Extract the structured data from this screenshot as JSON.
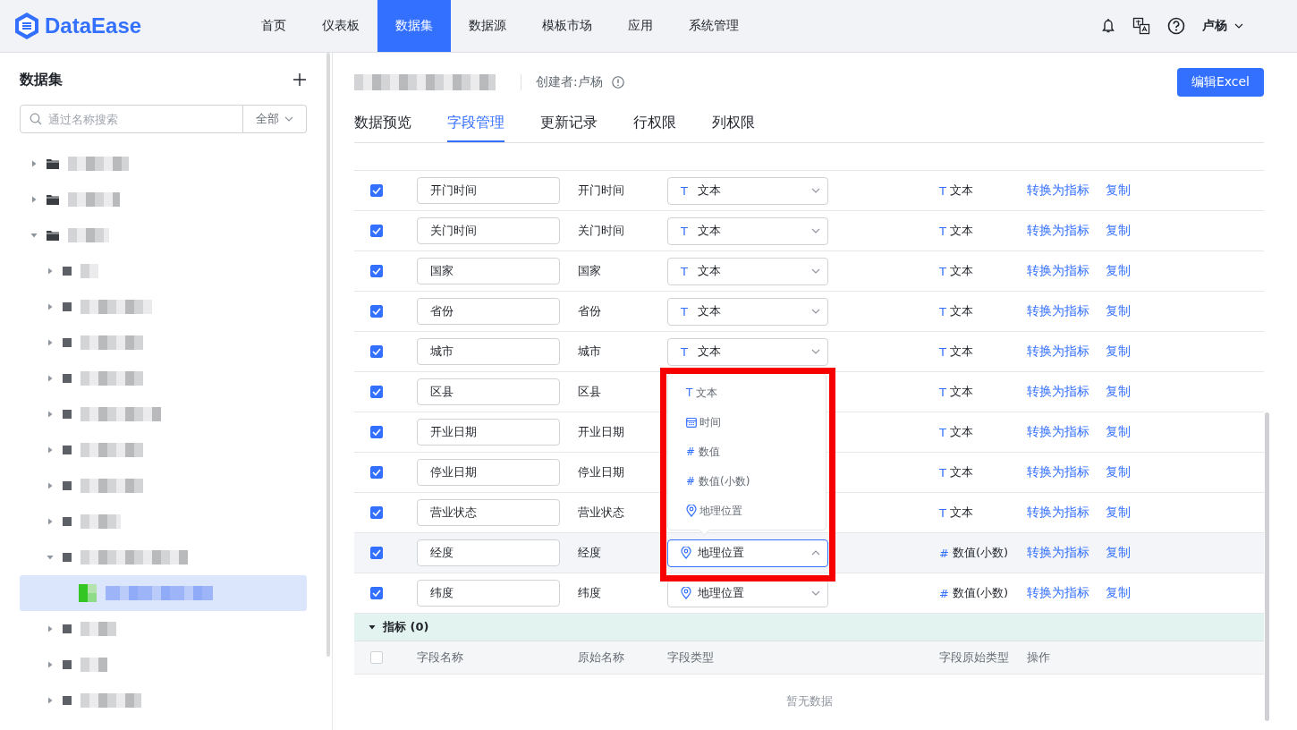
{
  "header": {
    "logo": "DataEase",
    "nav": [
      {
        "label": "首页",
        "selected": false
      },
      {
        "label": "仪表板",
        "selected": false
      },
      {
        "label": "数据集",
        "selected": true
      },
      {
        "label": "数据源",
        "selected": false
      },
      {
        "label": "模板市场",
        "selected": false
      },
      {
        "label": "应用",
        "selected": false
      },
      {
        "label": "系统管理",
        "selected": false
      }
    ],
    "user": "卢杨"
  },
  "sidebar": {
    "title": "数据集",
    "search": {
      "placeholder": "通过名称搜索"
    },
    "filter": "全部",
    "tree": [
      {
        "kind": "folder",
        "expanded": false,
        "selected": false
      },
      {
        "kind": "folder",
        "expanded": false,
        "selected": false
      },
      {
        "kind": "folder",
        "expanded": true,
        "selected": false,
        "children": [
          {
            "kind": "group",
            "expanded": false,
            "selected": false
          },
          {
            "kind": "group",
            "expanded": false,
            "selected": false
          },
          {
            "kind": "group",
            "expanded": false,
            "selected": false
          },
          {
            "kind": "group",
            "expanded": false,
            "selected": false
          },
          {
            "kind": "group",
            "expanded": false,
            "selected": false
          },
          {
            "kind": "group",
            "expanded": false,
            "selected": false
          },
          {
            "kind": "group",
            "expanded": false,
            "selected": false
          },
          {
            "kind": "group",
            "expanded": false,
            "selected": false
          },
          {
            "kind": "group",
            "expanded": true,
            "selected": false,
            "children": [
              {
                "kind": "dataset",
                "selected": true
              }
            ]
          },
          {
            "kind": "group",
            "expanded": false,
            "selected": false
          },
          {
            "kind": "group",
            "expanded": false,
            "selected": false
          },
          {
            "kind": "group",
            "expanded": false,
            "selected": false
          }
        ]
      }
    ]
  },
  "dataset": {
    "creator": "创建者:卢杨",
    "edit_button": "编辑Excel",
    "tabs": [
      {
        "label": "数据预览",
        "selected": false
      },
      {
        "label": "字段管理",
        "selected": true
      },
      {
        "label": "更新记录",
        "selected": false
      },
      {
        "label": "行权限",
        "selected": false
      },
      {
        "label": "列权限",
        "selected": false
      }
    ]
  },
  "fields": [
    {
      "checked": true,
      "name": "开门时间",
      "origin": "开门时间",
      "type": {
        "kind": "text",
        "icon": "T",
        "label": "文本"
      },
      "origin_type": {
        "icon": "T",
        "label": "文本"
      },
      "actions": [
        "转换为指标",
        "复制"
      ]
    },
    {
      "checked": true,
      "name": "关门时间",
      "origin": "关门时间",
      "type": {
        "kind": "text",
        "icon": "T",
        "label": "文本"
      },
      "origin_type": {
        "icon": "T",
        "label": "文本"
      },
      "actions": [
        "转换为指标",
        "复制"
      ]
    },
    {
      "checked": true,
      "name": "国家",
      "origin": "国家",
      "type": {
        "kind": "text",
        "icon": "T",
        "label": "文本"
      },
      "origin_type": {
        "icon": "T",
        "label": "文本"
      },
      "actions": [
        "转换为指标",
        "复制"
      ]
    },
    {
      "checked": true,
      "name": "省份",
      "origin": "省份",
      "type": {
        "kind": "text",
        "icon": "T",
        "label": "文本"
      },
      "origin_type": {
        "icon": "T",
        "label": "文本"
      },
      "actions": [
        "转换为指标",
        "复制"
      ]
    },
    {
      "checked": true,
      "name": "城市",
      "origin": "城市",
      "type": {
        "kind": "text",
        "icon": "T",
        "label": "文本"
      },
      "origin_type": {
        "icon": "T",
        "label": "文本"
      },
      "actions": [
        "转换为指标",
        "复制"
      ]
    },
    {
      "checked": true,
      "name": "区县",
      "origin": "区县",
      "origin_type": {
        "icon": "T",
        "label": "文本"
      },
      "actions": [
        "转换为指标",
        "复制"
      ]
    },
    {
      "checked": true,
      "name": "开业日期",
      "origin": "开业日期",
      "origin_type": {
        "icon": "T",
        "label": "文本"
      },
      "actions": [
        "转换为指标",
        "复制"
      ]
    },
    {
      "checked": true,
      "name": "停业日期",
      "origin": "停业日期",
      "origin_type": {
        "icon": "T",
        "label": "文本"
      },
      "actions": [
        "转换为指标",
        "复制"
      ]
    },
    {
      "checked": true,
      "name": "营业状态",
      "origin": "营业状态",
      "origin_type": {
        "icon": "T",
        "label": "文本"
      },
      "actions": [
        "转换为指标",
        "复制"
      ]
    },
    {
      "checked": true,
      "name": "经度",
      "origin": "经度",
      "type": {
        "kind": "location",
        "label": "地理位置"
      },
      "origin_type": {
        "icon": "#",
        "label": "数值(小数)"
      },
      "open": true,
      "annotated": true,
      "actions": [
        "转换为指标",
        "复制"
      ]
    },
    {
      "checked": true,
      "name": "纬度",
      "origin": "纬度",
      "type": {
        "kind": "location",
        "label": "地理位置"
      },
      "origin_type": {
        "icon": "#",
        "label": "数值(小数)"
      },
      "actions": [
        "转换为指标",
        "复制"
      ]
    }
  ],
  "type_options": [
    {
      "kind": "text",
      "icon": "T",
      "label": "文本"
    },
    {
      "kind": "time",
      "label": "时间"
    },
    {
      "kind": "number",
      "icon": "#",
      "label": "数值"
    },
    {
      "kind": "decimal",
      "icon": "#",
      "label": "数值(小数)"
    },
    {
      "kind": "location",
      "label": "地理位置"
    }
  ],
  "measures": {
    "title": "指标 (0)",
    "expanded": true,
    "checked": false,
    "columns": [
      "字段名称",
      "原始名称",
      "字段类型",
      "字段原始类型",
      "操作"
    ],
    "empty": "暂无数据"
  }
}
